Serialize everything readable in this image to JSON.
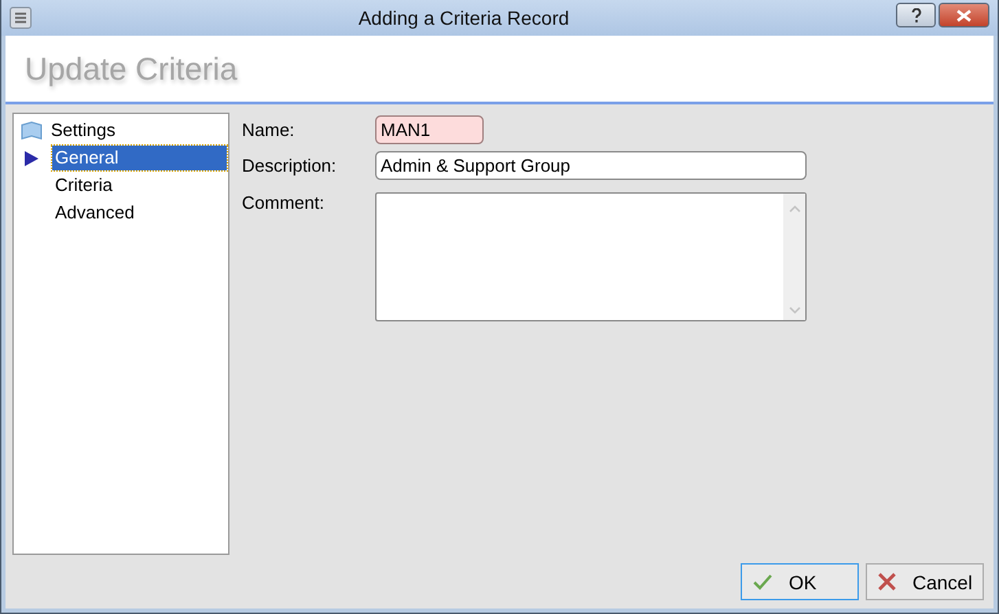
{
  "window": {
    "title": "Adding a Criteria Record"
  },
  "header": {
    "title": "Update Criteria"
  },
  "tree": [
    {
      "label": "Settings",
      "selected": false,
      "children": [
        {
          "label": "General",
          "selected": true
        },
        {
          "label": "Criteria",
          "selected": false
        },
        {
          "label": "Advanced",
          "selected": false
        }
      ]
    }
  ],
  "form": {
    "name": {
      "label": "Name:",
      "value": "MAN1",
      "invalid": true
    },
    "description": {
      "label": "Description:",
      "value": "Admin & Support Group"
    },
    "comment": {
      "label": "Comment:"
    }
  },
  "buttons": [
    {
      "kind": "ok",
      "label": "OK",
      "focused": true
    },
    {
      "kind": "cancel",
      "label": "Cancel",
      "focused": false
    }
  ]
}
